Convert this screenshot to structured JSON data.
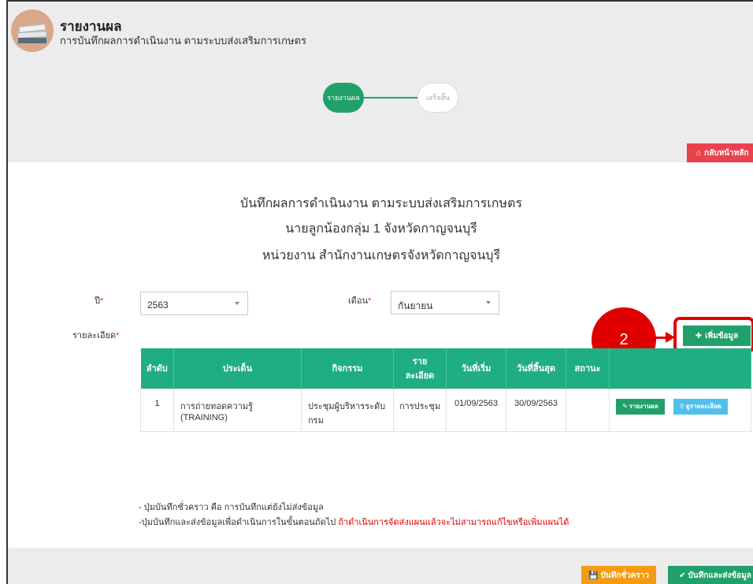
{
  "header": {
    "title": "รายงานผล",
    "subtitle": "การบันทึกผลการดำเนินงาน ตามระบบส่งเสริมการเกษตร"
  },
  "steps": {
    "active": "รายงานผล",
    "inactive": "เสร็จสิ้น"
  },
  "home_button": "กลับหน้าหลัก",
  "headings": {
    "line1": "บันทึกผลการดำเนินงาน ตามระบบส่งเสริมการเกษตร",
    "line2": "นายลูกน้องกลุ่ม 1 จังหวัดกาญจนบุรี",
    "line3": "หน่วยงาน สำนักงานเกษตรจังหวัดกาญจนบุรี"
  },
  "filters": {
    "year_label": "ปี",
    "year_value": "2563",
    "month_label": "เดือน",
    "month_value": "กันยายน",
    "detail_label": "รายละเอียด"
  },
  "add_button": "เพิ่มข้อมูล",
  "callout_number": "2",
  "table": {
    "headers": [
      "ลำดับ",
      "ประเด็น",
      "กิจกรรม",
      "ราย ละเอียด",
      "วันที่เริ่ม",
      "วันที่สิ้นสุด",
      "สถานะ",
      ""
    ],
    "rows": [
      {
        "no": "1",
        "issue_line1": "การถ่ายทอดความรู้",
        "issue_line2": "(TRAINING)",
        "activity_line1": "ประชุมผู้บริหารระดับ",
        "activity_line2": "กรม",
        "detail": "การประชุม",
        "start": "01/09/2563",
        "end": "30/09/2563",
        "status": "",
        "report_btn": "รายงานผล",
        "detail_btn": "ดูรายละเอียด"
      }
    ]
  },
  "notes": {
    "line1": "- ปุ่มบันทึกชั่วคราว คือ การบันทึกแต่ยังไม่ส่งข้อมูล",
    "line2": "-ปุ่มบันทึกและส่งข้อมูลเพื่อดำเนินการในขั้นตอนถัดไป",
    "warning": "ถ้าดำเนินการจัดส่งแผนแล้วจะไม่สามารถแก้ไขหรือเพิ่มแผนได้"
  },
  "footer": {
    "save_draft": "บันทึกชั่วคราว",
    "save_send": "บันทึกและส่งข้อมูล"
  },
  "colors": {
    "primary_green": "#22a06b",
    "table_header": "#1fae82",
    "danger_red": "#e8424d",
    "info_blue": "#4fc0ec",
    "warning_orange": "#f39c12"
  }
}
